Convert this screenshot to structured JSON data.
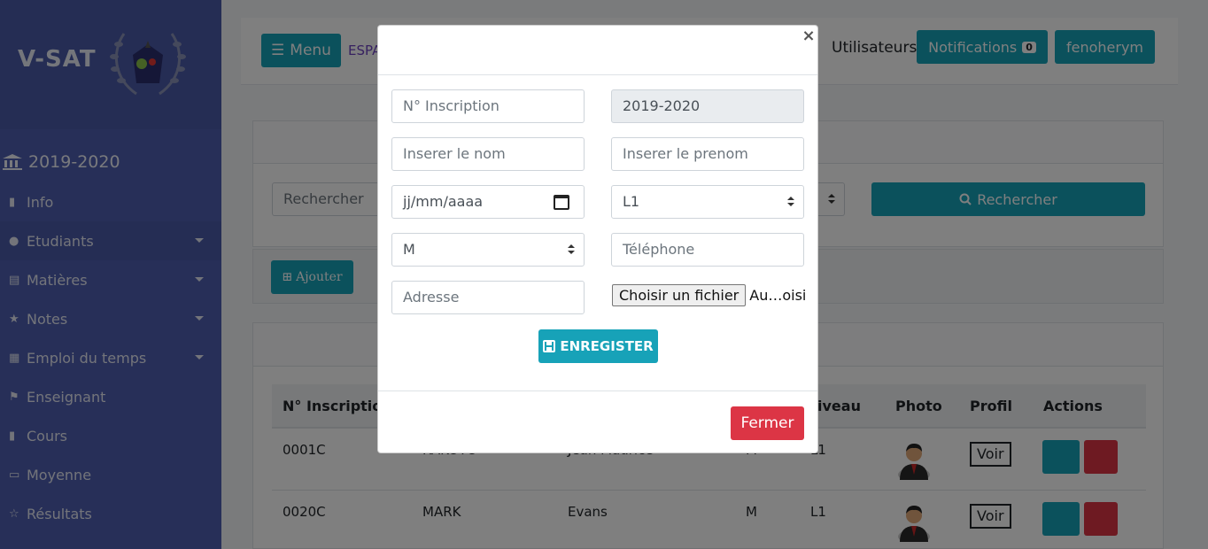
{
  "sidebar": {
    "brand": "V-SAT",
    "year": "2019-2020",
    "items": [
      {
        "label": "Info",
        "icon": "bookmark-icon",
        "caret": false
      },
      {
        "label": "Etudiants",
        "icon": "users-icon",
        "caret": true
      },
      {
        "label": "Matières",
        "icon": "book-icon",
        "caret": true
      },
      {
        "label": "Notes",
        "icon": "star-icon",
        "caret": true
      },
      {
        "label": "Emploi du temps",
        "icon": "calendar-icon",
        "caret": true
      },
      {
        "label": "Enseignant",
        "icon": "flag-icon",
        "caret": false
      },
      {
        "label": "Cours",
        "icon": "bookmark-icon",
        "caret": false
      },
      {
        "label": "Moyenne",
        "icon": "card-icon",
        "caret": false
      },
      {
        "label": "Résultats",
        "icon": "star-half-icon",
        "caret": false
      }
    ]
  },
  "topbar": {
    "menu_label": "Menu",
    "espace_label": "ESPA",
    "utilisateurs_label": "Utilisateurs",
    "notifications_label": "Notifications",
    "notifications_count": "0",
    "user_label": "fenoherym"
  },
  "search": {
    "placeholder": "Rechercher",
    "button_label": "Rechercher"
  },
  "add_button_label": "Ajouter",
  "table": {
    "headers": [
      "N° Inscription",
      "iveau",
      "Photo",
      "Profil",
      "Actions"
    ],
    "rows": [
      {
        "inscription": "0001C",
        "nom": "RAKOTO",
        "prenom": "Jean Maurice",
        "sexe": "M",
        "niveau": "L1",
        "profil": "Voir"
      },
      {
        "inscription": "0020C",
        "nom": "MARK",
        "prenom": "Evans",
        "sexe": "M",
        "niveau": "L1",
        "profil": "Voir"
      }
    ]
  },
  "modal": {
    "close_label": "×",
    "inscription_placeholder": "N° Inscription",
    "annee_value": "2019-2020",
    "nom_placeholder": "Inserer le nom",
    "prenom_placeholder": "Inserer le prenom",
    "date_placeholder": "jj/mm/aaaa",
    "niveau_value": "L1",
    "sexe_value": "M",
    "telephone_placeholder": "Téléphone",
    "adresse_placeholder": "Adresse",
    "file_button_label": "Choisir un fichier",
    "file_status": "Au…oisi",
    "save_label": "ENREGISTER",
    "fermer_label": "Fermer"
  },
  "colors": {
    "sidebar": "#4e5fb0",
    "teal": "#17a2b8",
    "danger": "#dc3545"
  }
}
